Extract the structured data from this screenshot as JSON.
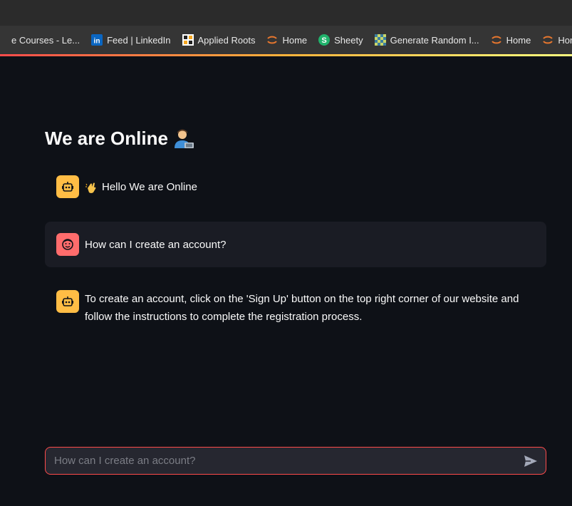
{
  "browser": {
    "bookmarks": [
      {
        "label": "e Courses - Le...",
        "icon": "course-icon"
      },
      {
        "label": "Feed | LinkedIn",
        "icon": "linkedin-icon"
      },
      {
        "label": "Applied Roots",
        "icon": "applied-roots-icon"
      },
      {
        "label": "Home",
        "icon": "orange-arc-icon"
      },
      {
        "label": "Sheety",
        "icon": "sheety-icon"
      },
      {
        "label": "Generate Random I...",
        "icon": "checker-icon"
      },
      {
        "label": "Home",
        "icon": "orange-arc-icon"
      },
      {
        "label": "Home Page - Se",
        "icon": "orange-arc-icon"
      }
    ]
  },
  "page": {
    "title": "We are Online",
    "title_emoji": "technologist-emoji"
  },
  "chat": {
    "messages": [
      {
        "role": "assistant",
        "avatar": "robot-icon",
        "emoji": "waving-hand-emoji",
        "text": "Hello We are Online"
      },
      {
        "role": "user",
        "avatar": "smiley-face-icon",
        "text": "How can I create an account?"
      },
      {
        "role": "assistant",
        "avatar": "robot-icon",
        "text": "To create an account, click on the 'Sign Up' button on the top right corner of our website and follow the instructions to complete the registration process."
      }
    ],
    "input": {
      "value": "",
      "placeholder": "How can I create an account?",
      "send_icon": "send-icon"
    }
  },
  "colors": {
    "background": "#0e1117",
    "user_bubble": "#1a1c24",
    "bot_avatar": "#ffbd45",
    "user_avatar": "#ff6c6c",
    "input_border": "#ff4b4b"
  }
}
